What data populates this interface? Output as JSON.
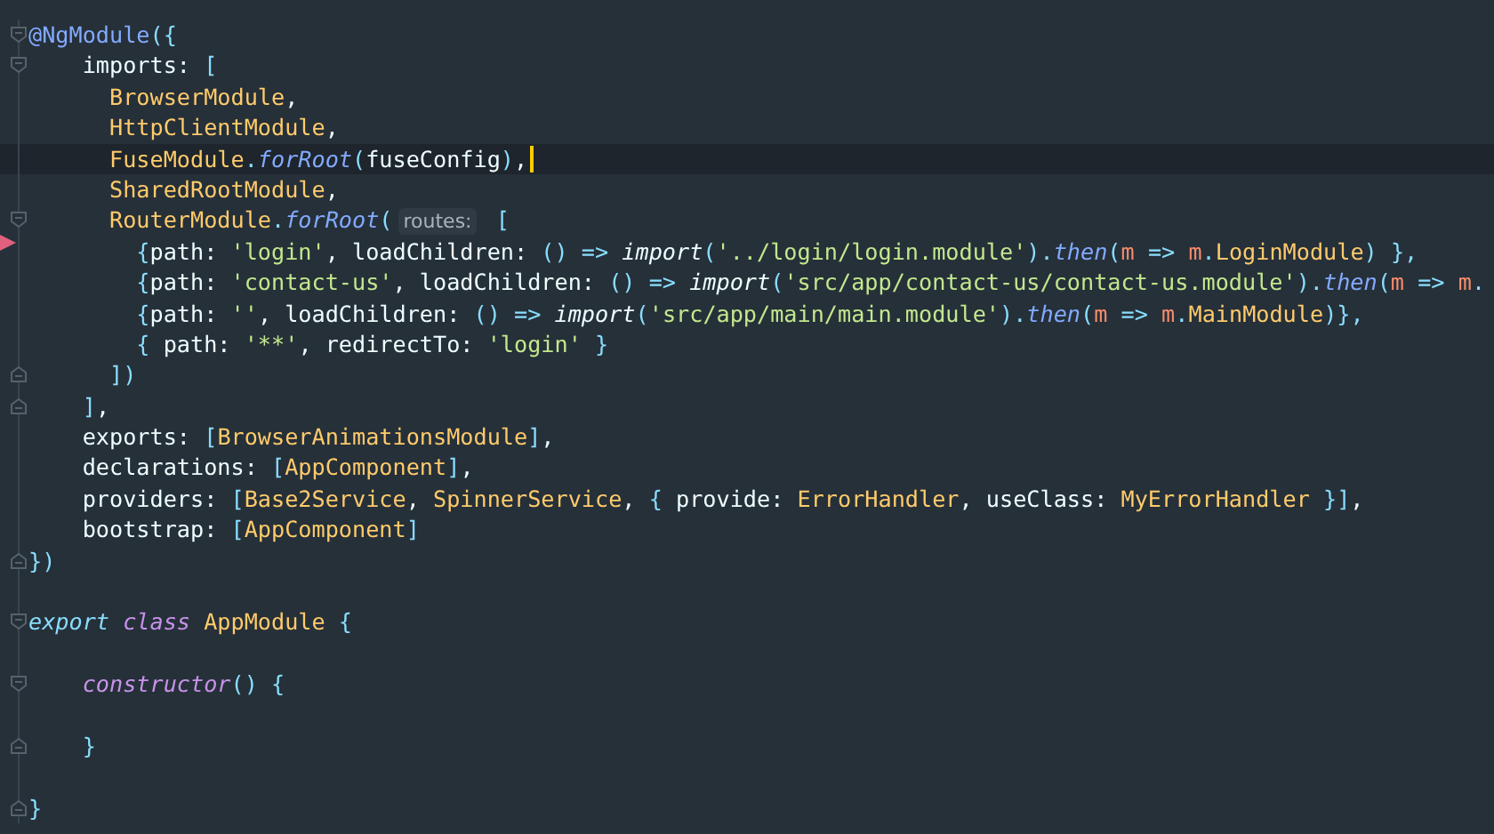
{
  "editor": {
    "lines": [
      {
        "current": false,
        "flagged": false,
        "cursor": false,
        "fold_start": true,
        "tokens": [
          {
            "kind": "decorator",
            "text": "@NgModule"
          },
          {
            "kind": "punct",
            "text": "({"
          }
        ]
      },
      {
        "current": false,
        "flagged": false,
        "cursor": false,
        "fold_start": true,
        "tokens": [
          {
            "kind": "plain",
            "text": "    imports: "
          },
          {
            "kind": "punct",
            "text": "["
          }
        ]
      },
      {
        "current": false,
        "flagged": false,
        "cursor": false,
        "tokens": [
          {
            "kind": "type",
            "text": "      BrowserModule"
          },
          {
            "kind": "plain",
            "text": ","
          }
        ]
      },
      {
        "current": false,
        "flagged": false,
        "cursor": false,
        "tokens": [
          {
            "kind": "type",
            "text": "      HttpClientModule"
          },
          {
            "kind": "plain",
            "text": ","
          }
        ]
      },
      {
        "current": true,
        "flagged": false,
        "cursor": true,
        "tokens": [
          {
            "kind": "type",
            "text": "      FuseModule"
          },
          {
            "kind": "punct",
            "text": "."
          },
          {
            "kind": "method",
            "text": "forRoot"
          },
          {
            "kind": "punct",
            "text": "("
          },
          {
            "kind": "plain",
            "text": "fuseConfig"
          },
          {
            "kind": "punct",
            "text": ")"
          },
          {
            "kind": "plain",
            "text": ","
          }
        ]
      },
      {
        "current": false,
        "flagged": false,
        "cursor": false,
        "tokens": [
          {
            "kind": "type",
            "text": "      SharedRootModule"
          },
          {
            "kind": "plain",
            "text": ","
          }
        ]
      },
      {
        "current": false,
        "flagged": false,
        "cursor": false,
        "fold_start": true,
        "tokens": [
          {
            "kind": "type",
            "text": "      RouterModule"
          },
          {
            "kind": "punct",
            "text": "."
          },
          {
            "kind": "method",
            "text": "forRoot"
          },
          {
            "kind": "punct",
            "text": "("
          },
          {
            "kind": "hint",
            "text": "routes:"
          },
          {
            "kind": "punct",
            "text": " ["
          }
        ]
      },
      {
        "current": false,
        "flagged": true,
        "cursor": false,
        "tokens": [
          {
            "kind": "punct",
            "text": "        {"
          },
          {
            "kind": "plain",
            "text": "path: "
          },
          {
            "kind": "string",
            "text": "'login'"
          },
          {
            "kind": "plain",
            "text": ", loadChildren: "
          },
          {
            "kind": "punct",
            "text": "() => "
          },
          {
            "kind": "keyword",
            "text": "import"
          },
          {
            "kind": "punct",
            "text": "("
          },
          {
            "kind": "string",
            "text": "'../login/login.module'"
          },
          {
            "kind": "punct",
            "text": ")."
          },
          {
            "kind": "method",
            "text": "then"
          },
          {
            "kind": "punct",
            "text": "("
          },
          {
            "kind": "param",
            "text": "m"
          },
          {
            "kind": "punct",
            "text": " => "
          },
          {
            "kind": "param",
            "text": "m"
          },
          {
            "kind": "punct",
            "text": "."
          },
          {
            "kind": "type",
            "text": "LoginModule"
          },
          {
            "kind": "punct",
            "text": ") },"
          }
        ]
      },
      {
        "current": false,
        "flagged": false,
        "cursor": false,
        "tokens": [
          {
            "kind": "punct",
            "text": "        {"
          },
          {
            "kind": "plain",
            "text": "path: "
          },
          {
            "kind": "string",
            "text": "'contact-us'"
          },
          {
            "kind": "plain",
            "text": ", loadChildren: "
          },
          {
            "kind": "punct",
            "text": "() => "
          },
          {
            "kind": "keyword",
            "text": "import"
          },
          {
            "kind": "punct",
            "text": "("
          },
          {
            "kind": "string",
            "text": "'src/app/contact-us/contact-us.module'"
          },
          {
            "kind": "punct",
            "text": ")."
          },
          {
            "kind": "method",
            "text": "then"
          },
          {
            "kind": "punct",
            "text": "("
          },
          {
            "kind": "param",
            "text": "m"
          },
          {
            "kind": "punct",
            "text": " => "
          },
          {
            "kind": "param",
            "text": "m"
          },
          {
            "kind": "punct",
            "text": "."
          }
        ]
      },
      {
        "current": false,
        "flagged": false,
        "cursor": false,
        "tokens": [
          {
            "kind": "punct",
            "text": "        {"
          },
          {
            "kind": "plain",
            "text": "path: "
          },
          {
            "kind": "string",
            "text": "''"
          },
          {
            "kind": "plain",
            "text": ", loadChildren: "
          },
          {
            "kind": "punct",
            "text": "() => "
          },
          {
            "kind": "keyword",
            "text": "import"
          },
          {
            "kind": "punct",
            "text": "("
          },
          {
            "kind": "string",
            "text": "'src/app/main/main.module'"
          },
          {
            "kind": "punct",
            "text": ")."
          },
          {
            "kind": "method",
            "text": "then"
          },
          {
            "kind": "punct",
            "text": "("
          },
          {
            "kind": "param",
            "text": "m"
          },
          {
            "kind": "punct",
            "text": " => "
          },
          {
            "kind": "param",
            "text": "m"
          },
          {
            "kind": "punct",
            "text": "."
          },
          {
            "kind": "type",
            "text": "MainModule"
          },
          {
            "kind": "punct",
            "text": ")},"
          }
        ]
      },
      {
        "current": false,
        "flagged": false,
        "cursor": false,
        "tokens": [
          {
            "kind": "punct",
            "text": "        { "
          },
          {
            "kind": "plain",
            "text": "path: "
          },
          {
            "kind": "string",
            "text": "'**'"
          },
          {
            "kind": "plain",
            "text": ", redirectTo: "
          },
          {
            "kind": "string",
            "text": "'login'"
          },
          {
            "kind": "punct",
            "text": " }"
          }
        ]
      },
      {
        "current": false,
        "flagged": false,
        "cursor": false,
        "fold_end": true,
        "tokens": [
          {
            "kind": "punct",
            "text": "      ])"
          }
        ]
      },
      {
        "current": false,
        "flagged": false,
        "cursor": false,
        "fold_end": true,
        "tokens": [
          {
            "kind": "punct",
            "text": "    ]"
          },
          {
            "kind": "plain",
            "text": ","
          }
        ]
      },
      {
        "current": false,
        "flagged": false,
        "cursor": false,
        "tokens": [
          {
            "kind": "plain",
            "text": "    exports: "
          },
          {
            "kind": "punct",
            "text": "["
          },
          {
            "kind": "type",
            "text": "BrowserAnimationsModule"
          },
          {
            "kind": "punct",
            "text": "]"
          },
          {
            "kind": "plain",
            "text": ","
          }
        ]
      },
      {
        "current": false,
        "flagged": false,
        "cursor": false,
        "tokens": [
          {
            "kind": "plain",
            "text": "    declarations: "
          },
          {
            "kind": "punct",
            "text": "["
          },
          {
            "kind": "type",
            "text": "AppComponent"
          },
          {
            "kind": "punct",
            "text": "]"
          },
          {
            "kind": "plain",
            "text": ","
          }
        ]
      },
      {
        "current": false,
        "flagged": false,
        "cursor": false,
        "tokens": [
          {
            "kind": "plain",
            "text": "    providers: "
          },
          {
            "kind": "punct",
            "text": "["
          },
          {
            "kind": "type",
            "text": "Base2Service"
          },
          {
            "kind": "plain",
            "text": ", "
          },
          {
            "kind": "type",
            "text": "SpinnerService"
          },
          {
            "kind": "plain",
            "text": ", "
          },
          {
            "kind": "punct",
            "text": "{ "
          },
          {
            "kind": "plain",
            "text": "provide: "
          },
          {
            "kind": "type",
            "text": "ErrorHandler"
          },
          {
            "kind": "plain",
            "text": ", useClass: "
          },
          {
            "kind": "type",
            "text": "MyErrorHandler"
          },
          {
            "kind": "punct",
            "text": " }]"
          },
          {
            "kind": "plain",
            "text": ","
          }
        ]
      },
      {
        "current": false,
        "flagged": false,
        "cursor": false,
        "tokens": [
          {
            "kind": "plain",
            "text": "    bootstrap: "
          },
          {
            "kind": "punct",
            "text": "["
          },
          {
            "kind": "type",
            "text": "AppComponent"
          },
          {
            "kind": "punct",
            "text": "]"
          }
        ]
      },
      {
        "current": false,
        "flagged": false,
        "cursor": false,
        "fold_end": true,
        "tokens": [
          {
            "kind": "punct",
            "text": "})"
          }
        ]
      },
      {
        "current": false,
        "flagged": false,
        "cursor": false
      },
      {
        "current": false,
        "flagged": false,
        "cursor": false,
        "fold_start": true,
        "tokens": [
          {
            "kind": "modifier",
            "text": "export "
          },
          {
            "kind": "storage",
            "text": "class "
          },
          {
            "kind": "type",
            "text": "AppModule"
          },
          {
            "kind": "punct",
            "text": " {"
          }
        ]
      },
      {
        "current": false,
        "flagged": false,
        "cursor": false
      },
      {
        "current": false,
        "flagged": false,
        "cursor": false,
        "fold_start": true,
        "tokens": [
          {
            "kind": "storage",
            "text": "    constructor"
          },
          {
            "kind": "punct",
            "text": "() {"
          }
        ]
      },
      {
        "current": false,
        "flagged": false,
        "cursor": false
      },
      {
        "current": false,
        "flagged": false,
        "cursor": false,
        "fold_end": true,
        "tokens": [
          {
            "kind": "punct",
            "text": "    }"
          }
        ]
      },
      {
        "current": false,
        "flagged": false,
        "cursor": false
      },
      {
        "current": false,
        "flagged": false,
        "cursor": false,
        "fold_end": true,
        "tokens": [
          {
            "kind": "punct",
            "text": "}"
          }
        ]
      }
    ]
  }
}
